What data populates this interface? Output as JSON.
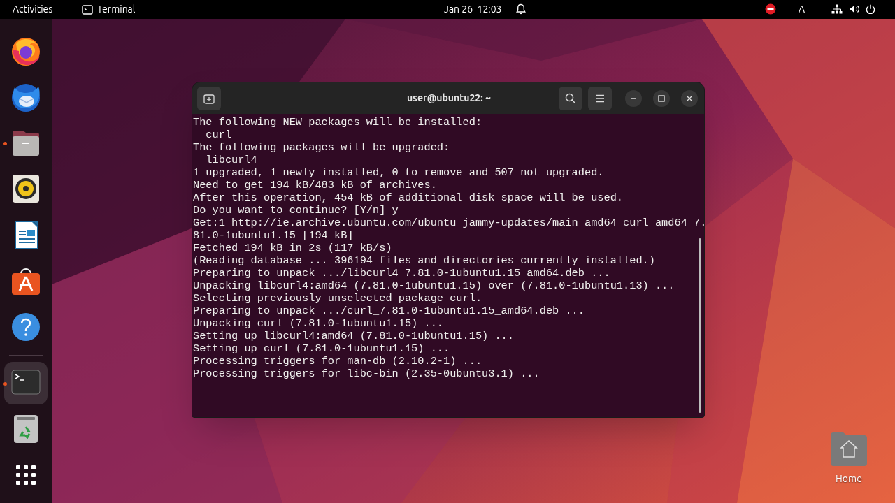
{
  "top_bar": {
    "activities": "Activities",
    "app_menu": "Terminal",
    "clock": "Jan 26  12:03",
    "input_source": "A"
  },
  "dock": {
    "items": [
      {
        "kind": "firefox",
        "running": false,
        "selected": false
      },
      {
        "kind": "thunderbird",
        "running": false,
        "selected": false
      },
      {
        "kind": "files",
        "running": true,
        "selected": false
      },
      {
        "kind": "rhythmbox",
        "running": false,
        "selected": false
      },
      {
        "kind": "writer",
        "running": false,
        "selected": false
      },
      {
        "kind": "software",
        "running": false,
        "selected": false
      },
      {
        "kind": "help",
        "running": false,
        "selected": false
      },
      {
        "kind": "separator"
      },
      {
        "kind": "terminal",
        "running": true,
        "selected": true
      },
      {
        "kind": "trash",
        "running": false,
        "selected": false
      }
    ]
  },
  "terminal": {
    "title": "user@ubuntu22: ~",
    "lines": [
      "The following NEW packages will be installed:",
      "  curl",
      "The following packages will be upgraded:",
      "  libcurl4",
      "1 upgraded, 1 newly installed, 0 to remove and 507 not upgraded.",
      "Need to get 194 kB/483 kB of archives.",
      "After this operation, 454 kB of additional disk space will be used.",
      "Do you want to continue? [Y/n] y",
      "Get:1 http://ie.archive.ubuntu.com/ubuntu jammy-updates/main amd64 curl amd64 7.",
      "81.0-1ubuntu1.15 [194 kB]",
      "Fetched 194 kB in 2s (117 kB/s)",
      "(Reading database ... 396194 files and directories currently installed.)",
      "Preparing to unpack .../libcurl4_7.81.0-1ubuntu1.15_amd64.deb ...",
      "Unpacking libcurl4:amd64 (7.81.0-1ubuntu1.15) over (7.81.0-1ubuntu1.13) ...",
      "Selecting previously unselected package curl.",
      "Preparing to unpack .../curl_7.81.0-1ubuntu1.15_amd64.deb ...",
      "Unpacking curl (7.81.0-1ubuntu1.15) ...",
      "Setting up libcurl4:amd64 (7.81.0-1ubuntu1.15) ...",
      "Setting up curl (7.81.0-1ubuntu1.15) ...",
      "Processing triggers for man-db (2.10.2-1) ...",
      "Processing triggers for libc-bin (2.35-0ubuntu3.1) ..."
    ]
  },
  "desktop_icons": [
    {
      "kind": "home",
      "label": "Home"
    }
  ]
}
